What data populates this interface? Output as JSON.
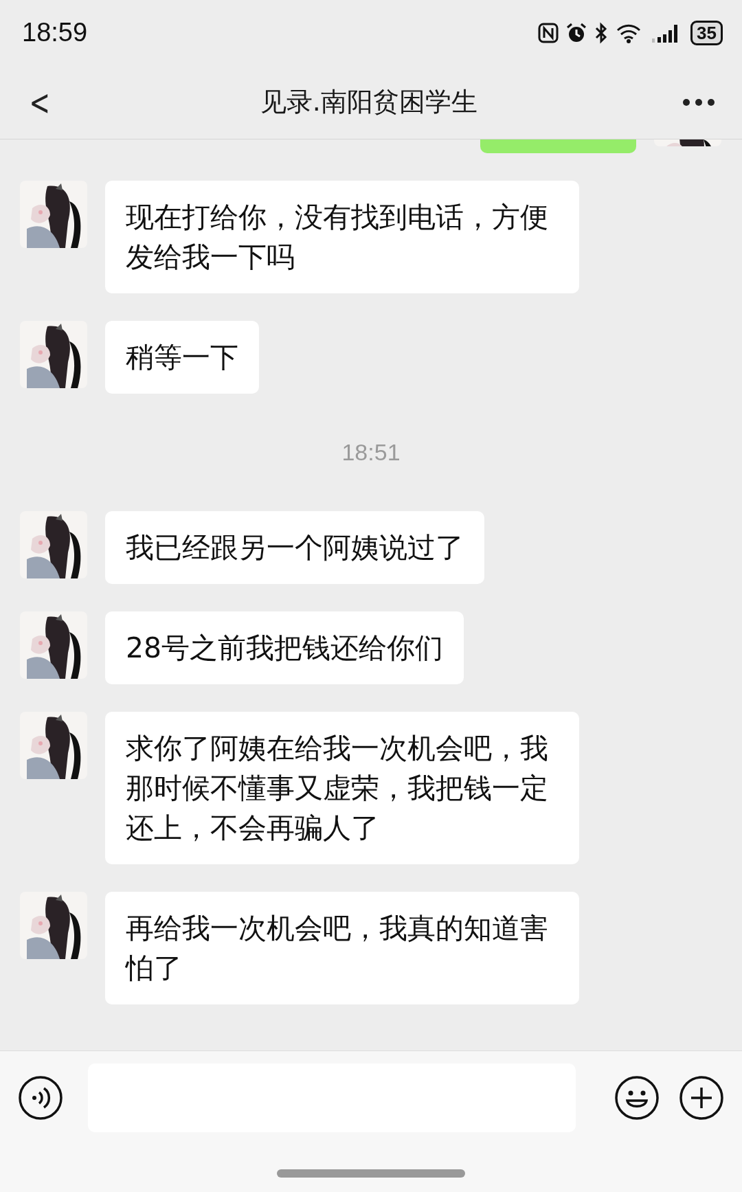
{
  "status_bar": {
    "time": "18:59",
    "battery": "35"
  },
  "header": {
    "back": "<",
    "title": "见录.南阳贫困学生"
  },
  "messages": [
    {
      "kind": "outgoing_cut"
    },
    {
      "kind": "incoming",
      "text": " 现在打给你，没有找到电话，方便发给我一下吗"
    },
    {
      "kind": "incoming",
      "text": "稍等一下"
    },
    {
      "kind": "time",
      "text": "18:51"
    },
    {
      "kind": "incoming",
      "text": "我已经跟另一个阿姨说过了"
    },
    {
      "kind": "incoming",
      "text": "28号之前我把钱还给你们"
    },
    {
      "kind": "incoming",
      "text": "求你了阿姨在给我一次机会吧，我那时候不懂事又虚荣，我把钱一定还上，不会再骗人了"
    },
    {
      "kind": "incoming",
      "text": "再给我一次机会吧，我真的知道害怕了"
    }
  ]
}
